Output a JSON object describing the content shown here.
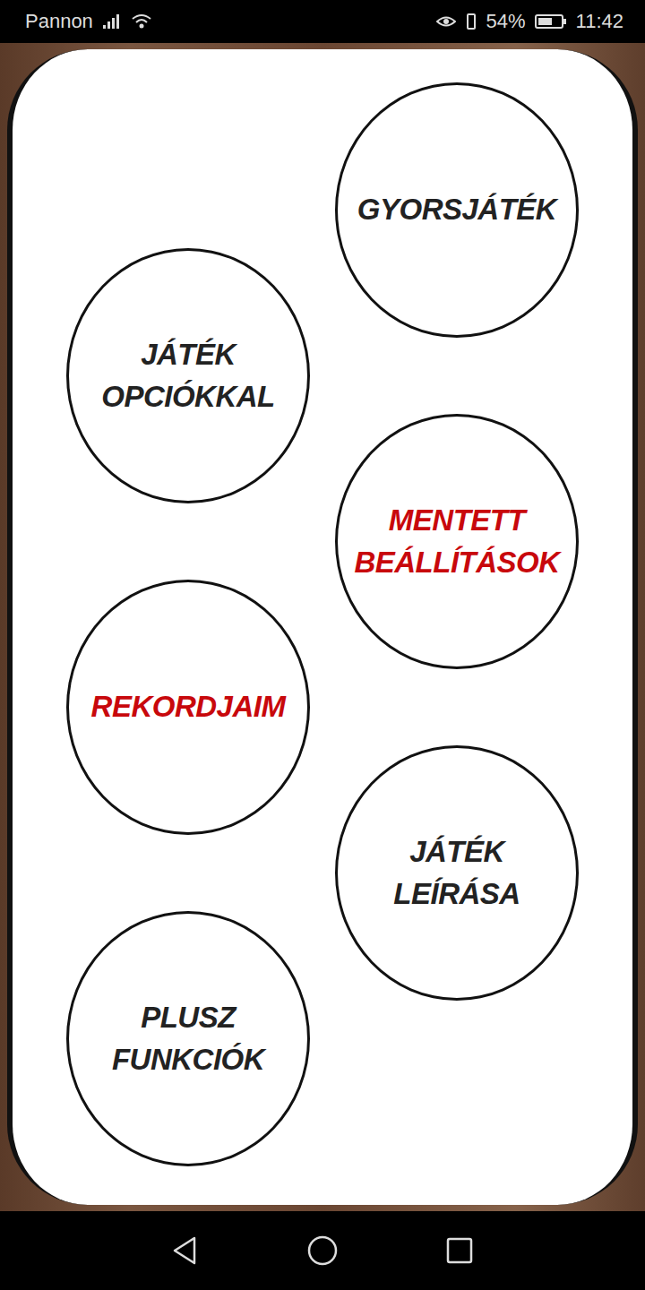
{
  "status_bar": {
    "carrier": "Pannon",
    "battery": "54%",
    "time": "11:42"
  },
  "menu": [
    {
      "lines": [
        "GYORSJÁTÉK"
      ],
      "color": "#222222"
    },
    {
      "lines": [
        "JÁTÉK",
        "OPCIÓKKAL"
      ],
      "color": "#222222"
    },
    {
      "lines": [
        "MENTETT",
        "BEÁLLÍTÁSOK"
      ],
      "color": "#c8080c"
    },
    {
      "lines": [
        "REKORDJAIM"
      ],
      "color": "#c8080c"
    },
    {
      "lines": [
        "JÁTÉK",
        "LEÍRÁSA"
      ],
      "color": "#222222"
    },
    {
      "lines": [
        "PLUSZ",
        "FUNKCIÓK"
      ],
      "color": "#222222"
    }
  ]
}
